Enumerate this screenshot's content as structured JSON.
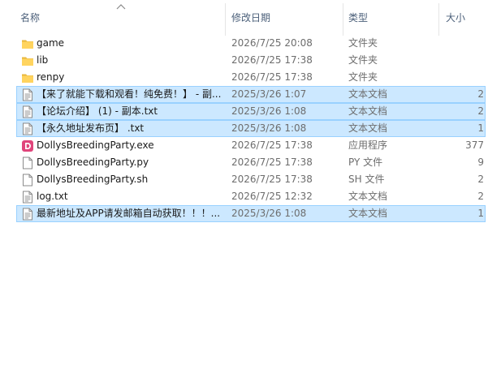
{
  "columns": {
    "name": "名称",
    "date": "修改日期",
    "type": "类型",
    "size": "大小"
  },
  "files": [
    {
      "name": "game",
      "date": "2026/7/25 20:08",
      "type": "文件夹",
      "size": "",
      "icon": "folder-icon",
      "selected": false
    },
    {
      "name": "lib",
      "date": "2026/7/25 17:38",
      "type": "文件夹",
      "size": "",
      "icon": "folder-icon",
      "selected": false
    },
    {
      "name": "renpy",
      "date": "2026/7/25 17:38",
      "type": "文件夹",
      "size": "",
      "icon": "folder-icon",
      "selected": false
    },
    {
      "name": "【来了就能下载和观看！纯免费！】 - 副...",
      "date": "2025/3/26 1:07",
      "type": "文本文档",
      "size": "2",
      "icon": "text-file-icon",
      "selected": true
    },
    {
      "name": "【论坛介绍】 (1) - 副本.txt",
      "date": "2025/3/26 1:08",
      "type": "文本文档",
      "size": "2",
      "icon": "text-file-icon",
      "selected": true
    },
    {
      "name": "【永久地址发布页】 .txt",
      "date": "2025/3/26 1:08",
      "type": "文本文档",
      "size": "1",
      "icon": "text-file-icon",
      "selected": true
    },
    {
      "name": "DollysBreedingParty.exe",
      "date": "2026/7/25 17:38",
      "type": "应用程序",
      "size": "377",
      "icon": "app-icon",
      "selected": false
    },
    {
      "name": "DollysBreedingParty.py",
      "date": "2026/7/25 17:38",
      "type": "PY 文件",
      "size": "9",
      "icon": "file-icon",
      "selected": false
    },
    {
      "name": "DollysBreedingParty.sh",
      "date": "2026/7/25 17:38",
      "type": "SH 文件",
      "size": "2",
      "icon": "file-icon",
      "selected": false
    },
    {
      "name": "log.txt",
      "date": "2026/7/25 12:32",
      "type": "文本文档",
      "size": "2",
      "icon": "text-file-icon",
      "selected": false
    },
    {
      "name": "最新地址及APP请发邮箱自动获取！！！...",
      "date": "2025/3/26 1:08",
      "type": "文本文档",
      "size": "1",
      "icon": "text-file-icon",
      "selected": true
    }
  ],
  "colors": {
    "selection": "#cce8ff",
    "selection_border": "#99d1ff",
    "folder": "#ffd45f",
    "header_text": "#4c607a",
    "app_icon": "#e0457b"
  }
}
